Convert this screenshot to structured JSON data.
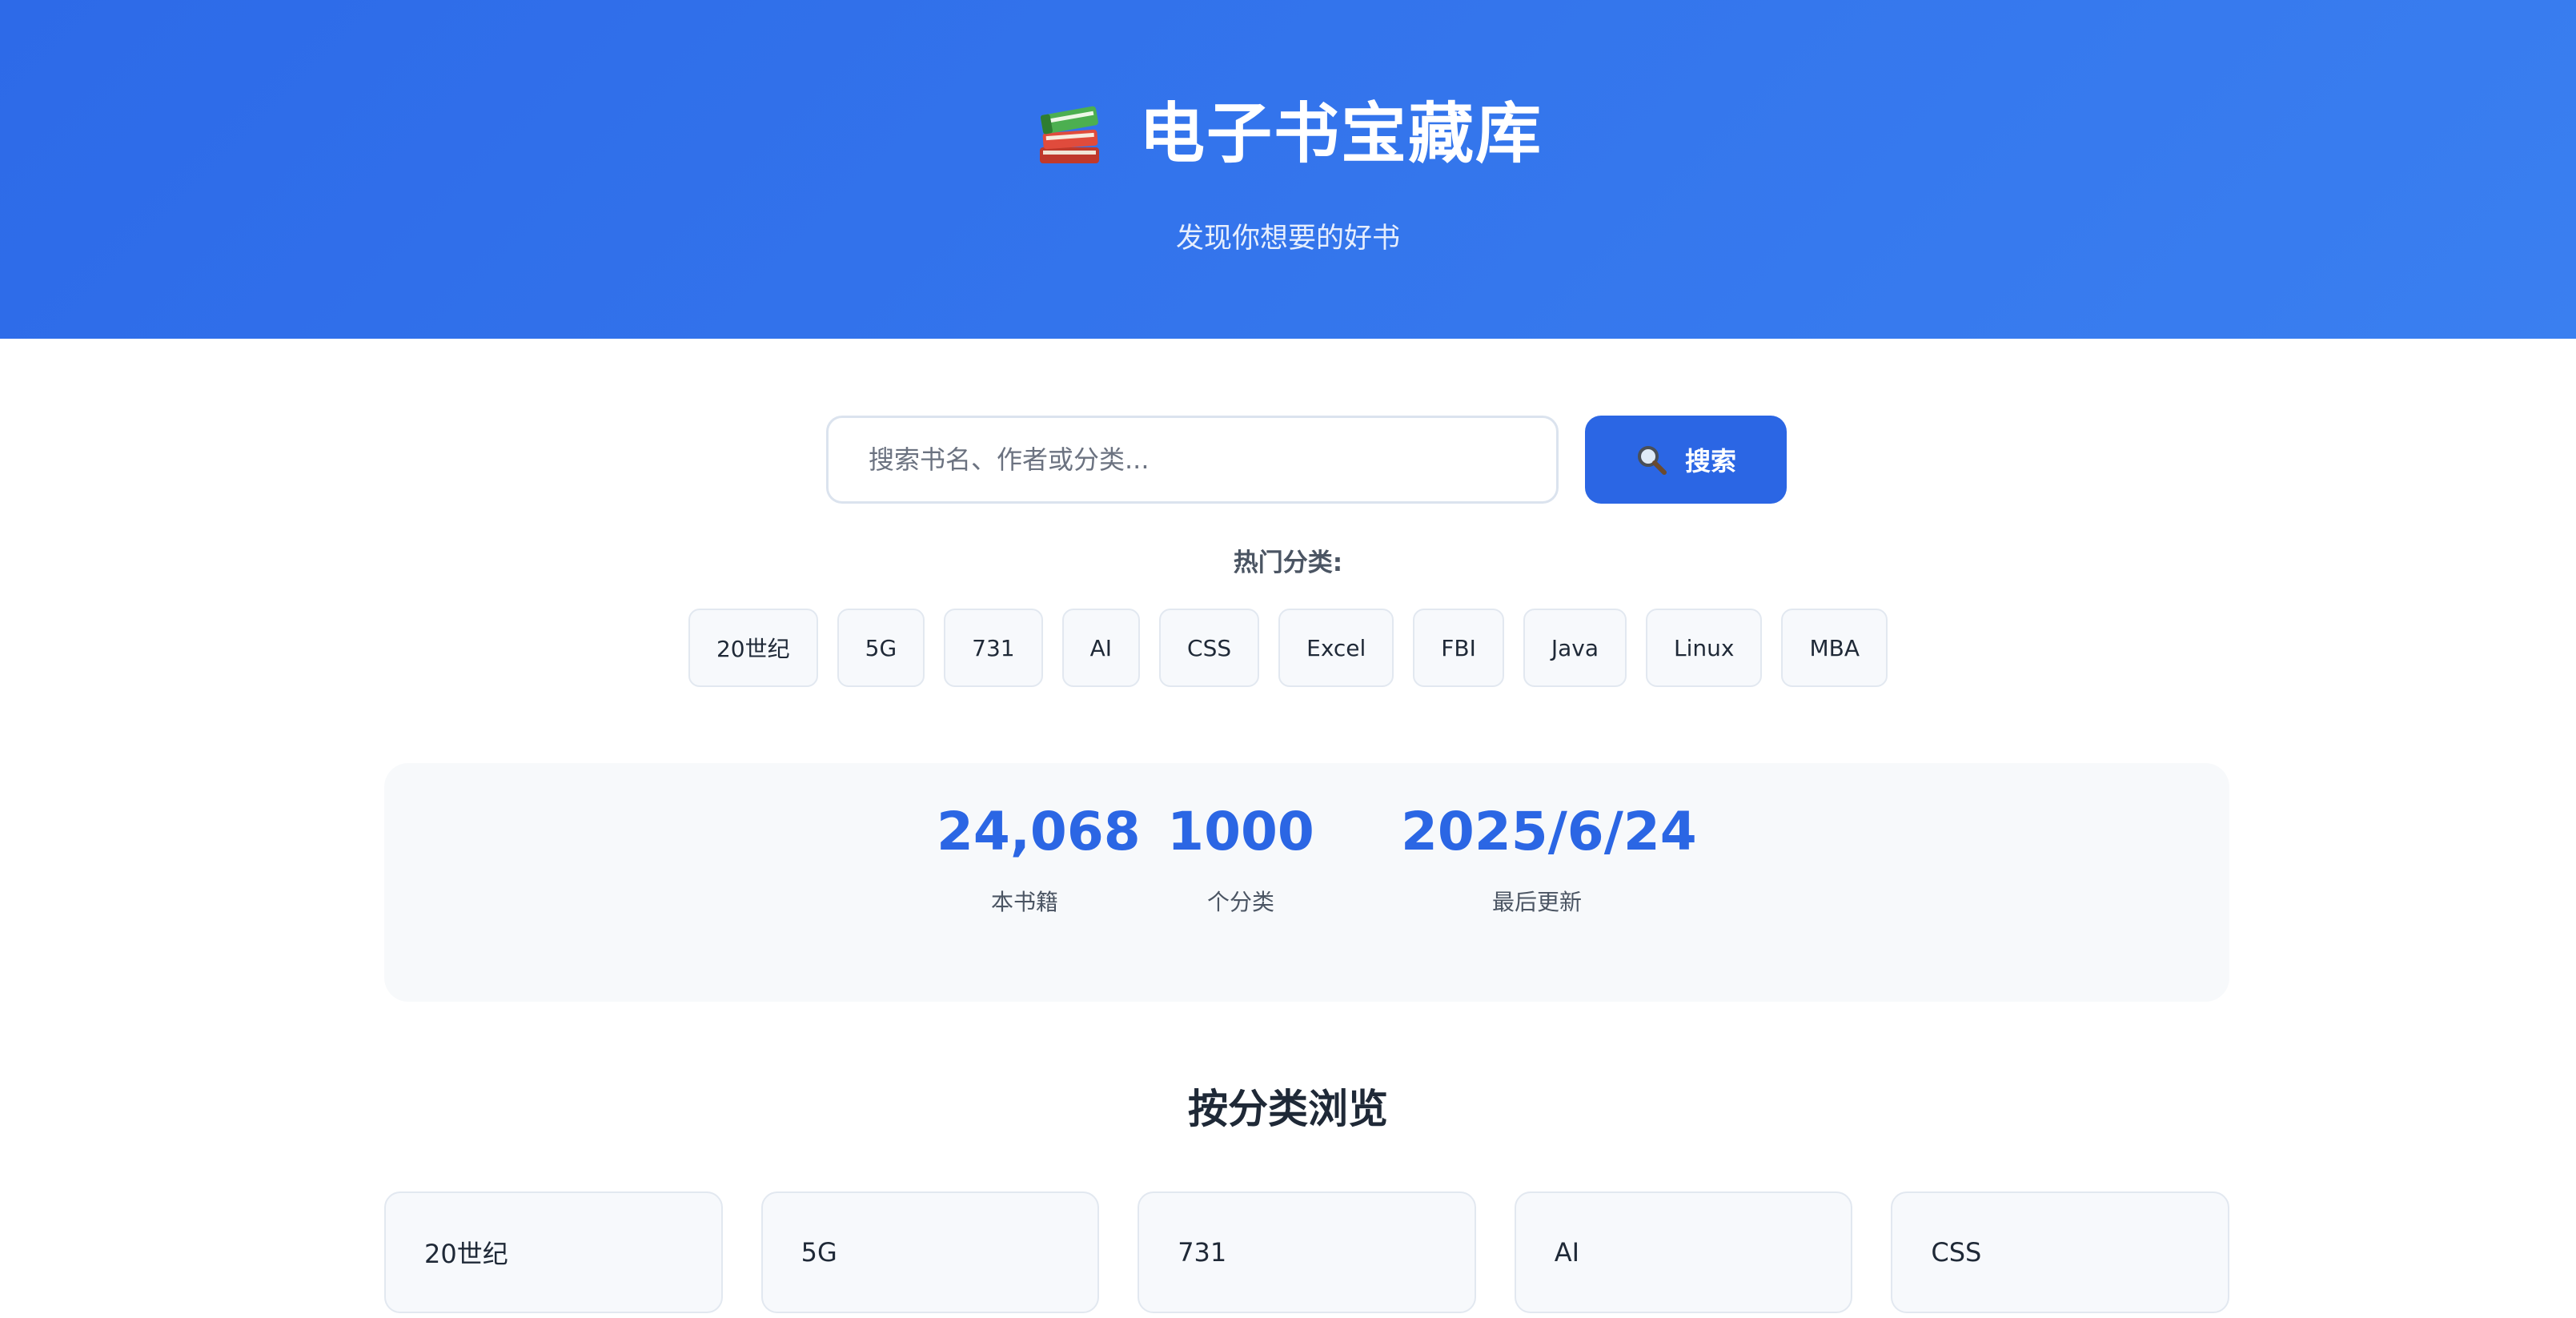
{
  "header": {
    "icon": "books-icon",
    "title": "电子书宝藏库",
    "subtitle": "发现你想要的好书"
  },
  "search": {
    "placeholder": "搜索书名、作者或分类...",
    "value": "",
    "button_icon": "magnifier-icon",
    "button_label": "搜索"
  },
  "hot_categories": {
    "label": "热门分类:",
    "tags": [
      "20世纪",
      "5G",
      "731",
      "AI",
      "CSS",
      "Excel",
      "FBI",
      "Java",
      "Linux",
      "MBA"
    ]
  },
  "stats": {
    "items": [
      {
        "value": "24,068",
        "label": "本书籍"
      },
      {
        "value": "1000",
        "label": "个分类"
      },
      {
        "value": "2025/6/24",
        "label": "最后更新"
      }
    ]
  },
  "browse": {
    "title": "按分类浏览",
    "categories": [
      "20世纪",
      "5G",
      "731",
      "AI",
      "CSS"
    ]
  },
  "colors": {
    "header_gradient_start": "#2d6ae8",
    "header_gradient_end": "#3a7ff0",
    "accent": "#2b66e4",
    "panel_bg": "#f7f9fb",
    "text_primary": "#1f2937",
    "text_secondary": "#4b5563"
  }
}
